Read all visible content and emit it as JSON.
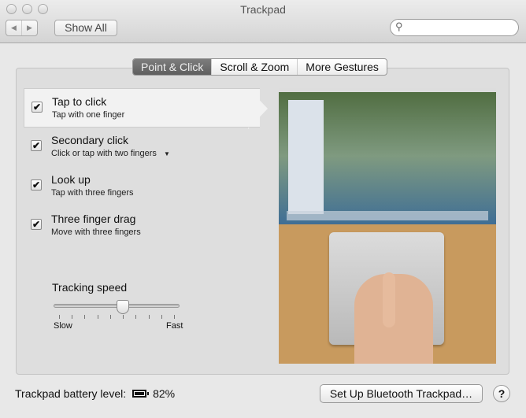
{
  "window": {
    "title": "Trackpad"
  },
  "toolbar": {
    "back_icon": "◀",
    "forward_icon": "▶",
    "show_all": "Show All",
    "search_placeholder": "",
    "search_icon": "magnifier"
  },
  "tabs": [
    {
      "label": "Point & Click",
      "active": true
    },
    {
      "label": "Scroll & Zoom",
      "active": false
    },
    {
      "label": "More Gestures",
      "active": false
    }
  ],
  "options": [
    {
      "label": "Tap to click",
      "description": "Tap with one finger",
      "checked": true,
      "selected": true
    },
    {
      "label": "Secondary click",
      "description": "Click or tap with two fingers",
      "checked": true,
      "has_dropdown": true
    },
    {
      "label": "Look up",
      "description": "Tap with three fingers",
      "checked": true
    },
    {
      "label": "Three finger drag",
      "description": "Move with three fingers",
      "checked": true
    }
  ],
  "check_mark": "✔",
  "dropdown_arrow": "▼",
  "tracking": {
    "label": "Tracking speed",
    "min_label": "Slow",
    "max_label": "Fast",
    "value": 0.556,
    "ticks": 10
  },
  "footer": {
    "battery_label": "Trackpad battery level:",
    "battery_value": "82%",
    "setup_button": "Set Up Bluetooth Trackpad…",
    "help": "?"
  }
}
